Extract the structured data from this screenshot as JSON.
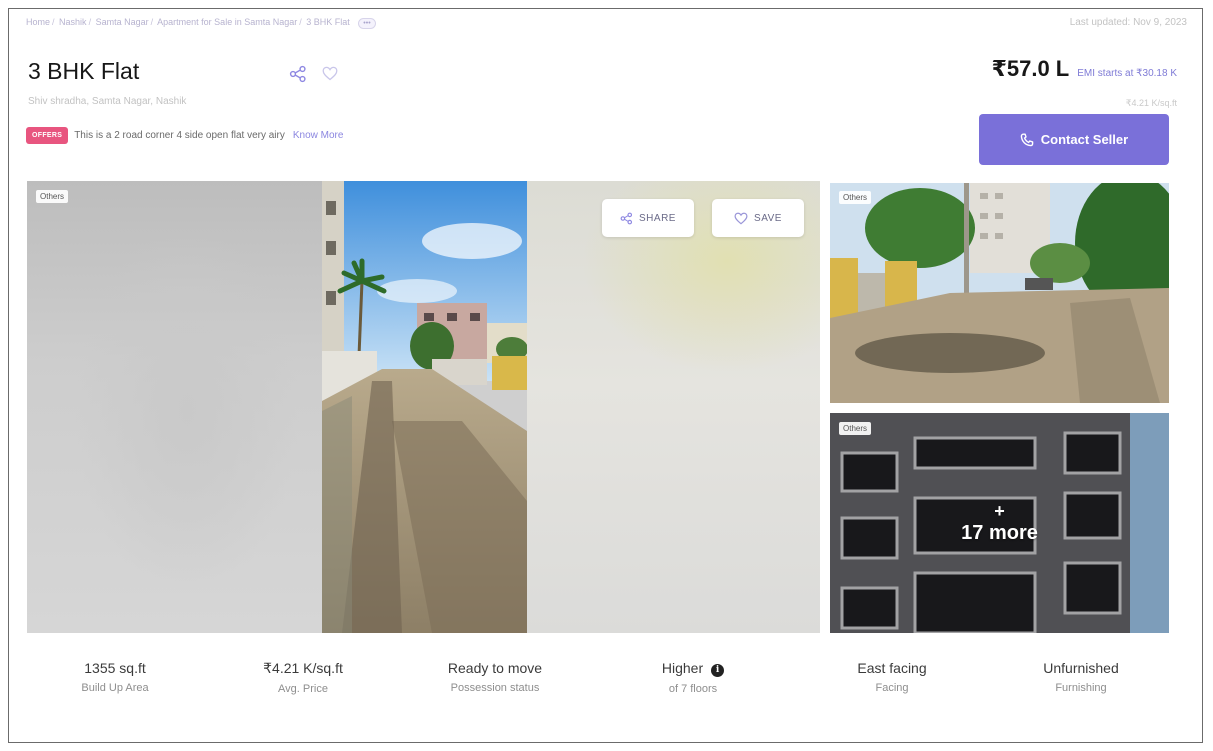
{
  "breadcrumb": {
    "items": [
      "Home",
      "Nashik",
      "Samta Nagar",
      "Apartment for Sale in Samta Nagar",
      "3 BHK Flat"
    ],
    "more_label": "•••"
  },
  "last_updated": "Last updated: Nov 9, 2023",
  "listing": {
    "title": "3 BHK Flat",
    "address": "Shiv shradha, Samta Nagar, Nashik",
    "share_icon": "share-icon",
    "heart_icon": "heart-icon"
  },
  "offer": {
    "badge": "OFFERS",
    "text": "This is a 2 road corner 4 side open flat very airy",
    "link": "Know More"
  },
  "price": {
    "amount": "₹57.0 L",
    "emi": "EMI starts at ₹30.18 K",
    "per_sqft": "₹4.21 K/sq.ft"
  },
  "contact_button": {
    "label": "Contact Seller",
    "icon": "phone-icon"
  },
  "gallery": {
    "main_tag": "Others",
    "share_label": "SHARE",
    "save_label": "SAVE",
    "side_top_tag": "Others",
    "side_bottom_tag": "Others",
    "more_plus": "+",
    "more_count": "17 more"
  },
  "stats": [
    {
      "value": "1355 sq.ft",
      "label": "Build Up Area"
    },
    {
      "value": "₹4.21 K/sq.ft",
      "label": "Avg. Price"
    },
    {
      "value": "Ready to move",
      "label": "Possession status"
    },
    {
      "value": "Higher",
      "label": "of 7 floors",
      "info_icon": "info-icon"
    },
    {
      "value": "East facing",
      "label": "Facing"
    },
    {
      "value": "Unfurnished",
      "label": "Furnishing"
    }
  ],
  "colors": {
    "accent": "#7a70d9",
    "offer_badge": "#e8557f",
    "link": "#8b86e0"
  }
}
